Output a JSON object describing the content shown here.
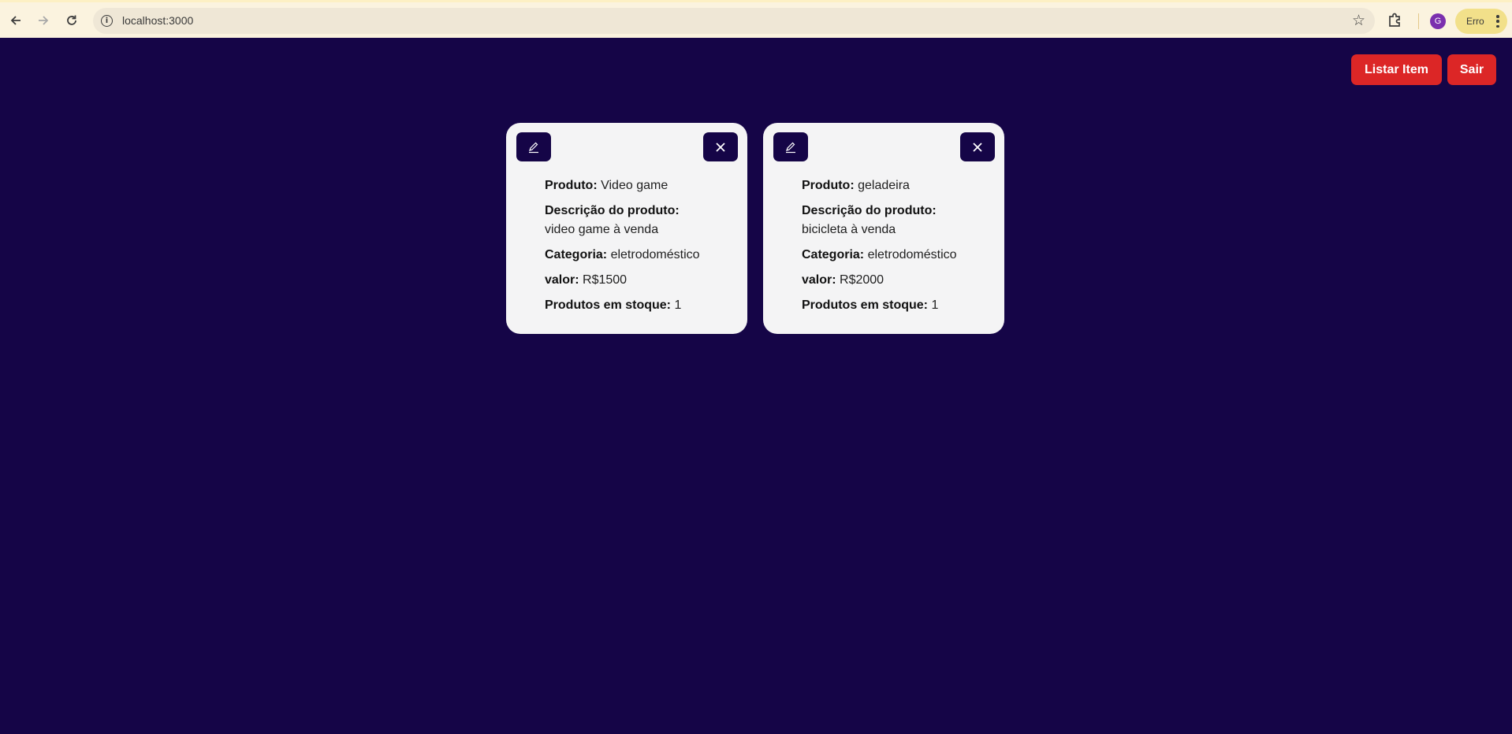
{
  "browser": {
    "url": "localhost:3000",
    "profile_initial": "G",
    "status_chip": "Erro"
  },
  "header": {
    "list_button": "Listar Item",
    "exit_button": "Sair"
  },
  "labels": {
    "product": "Produto:",
    "description": "Descrição do produto:",
    "category": "Categoria:",
    "price": "valor:",
    "stock": "Produtos em stoque:"
  },
  "products": [
    {
      "name": "Video game",
      "description": "video game à venda",
      "category": "eletrodoméstico",
      "price": "R$1500",
      "stock": "1"
    },
    {
      "name": "geladeira",
      "description": "bicicleta à venda",
      "category": "eletrodoméstico",
      "price": "R$2000",
      "stock": "1"
    }
  ],
  "colors": {
    "background": "#150547",
    "card": "#f4f4f5",
    "primary_button": "#dc2626",
    "icon_button": "#150547"
  },
  "icons": [
    "back-arrow-icon",
    "forward-arrow-icon",
    "reload-icon",
    "site-info-icon",
    "bookmark-star-icon",
    "extensions-icon",
    "more-vert-icon",
    "pencil-icon",
    "close-icon"
  ]
}
